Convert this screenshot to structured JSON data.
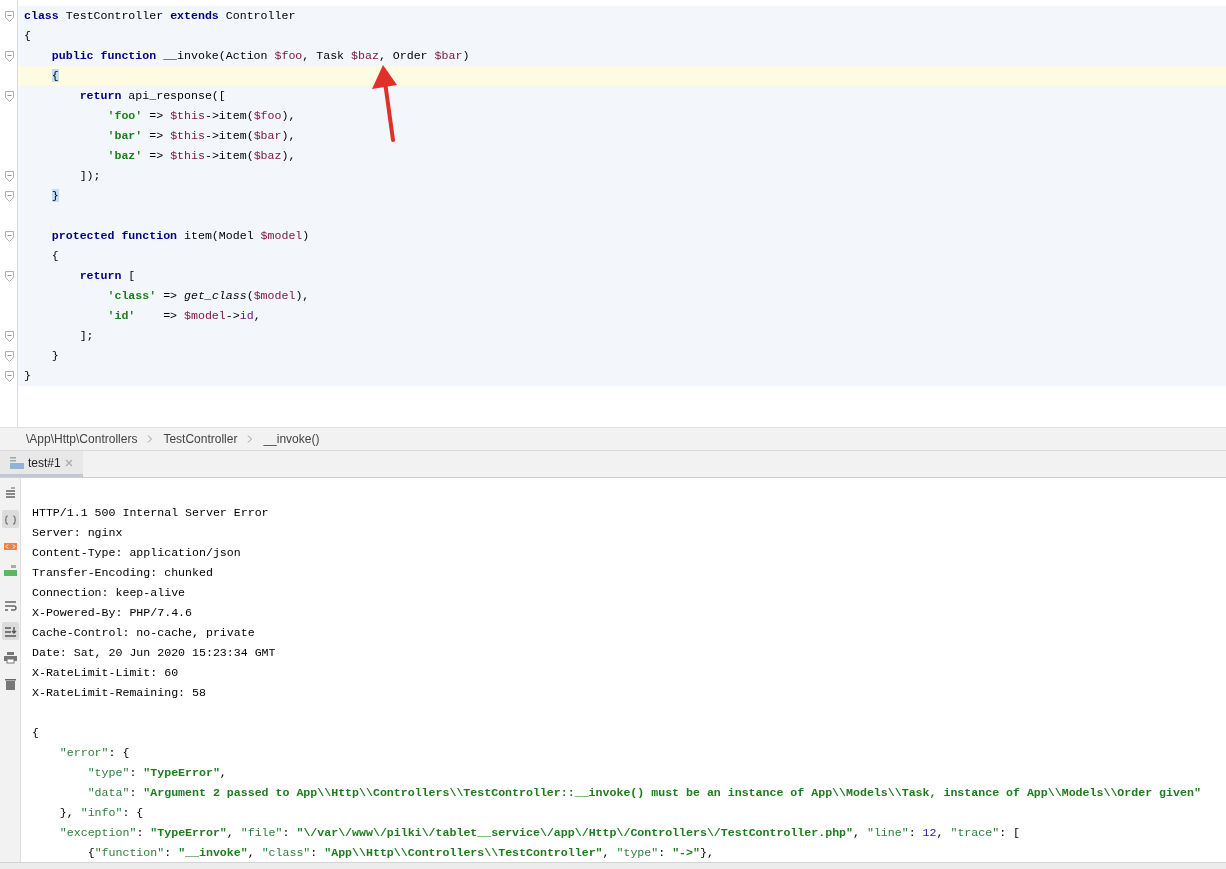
{
  "editor": {
    "lines": [
      {
        "fold": true,
        "current": false,
        "tokens": [
          {
            "kind": "kw",
            "text": "class"
          },
          {
            "kind": "plain",
            "text": " TestController "
          },
          {
            "kind": "kw",
            "text": "extends"
          },
          {
            "kind": "plain",
            "text": " Controller"
          }
        ]
      },
      {
        "fold": false,
        "current": false,
        "tokens": [
          {
            "kind": "plain",
            "text": "{"
          }
        ]
      },
      {
        "fold": true,
        "current": false,
        "tokens": [
          {
            "kind": "kw",
            "text": "    public function"
          },
          {
            "kind": "plain",
            "text": " __invoke(Action "
          },
          {
            "kind": "var",
            "text": "$foo"
          },
          {
            "kind": "plain",
            "text": ", Task "
          },
          {
            "kind": "var",
            "text": "$baz"
          },
          {
            "kind": "plain",
            "text": ", Order "
          },
          {
            "kind": "var",
            "text": "$bar"
          },
          {
            "kind": "plain",
            "text": ")"
          }
        ]
      },
      {
        "fold": false,
        "current": true,
        "brace_match": true,
        "tokens": [
          {
            "kind": "plain",
            "text": "    {"
          }
        ]
      },
      {
        "fold": true,
        "current": false,
        "tokens": [
          {
            "kind": "kw",
            "text": "        return"
          },
          {
            "kind": "plain",
            "text": " api_response(["
          }
        ]
      },
      {
        "fold": false,
        "current": false,
        "tokens": [
          {
            "kind": "str",
            "text": "            'foo'"
          },
          {
            "kind": "plain",
            "text": " => "
          },
          {
            "kind": "var",
            "text": "$this"
          },
          {
            "kind": "plain",
            "text": "->item("
          },
          {
            "kind": "var",
            "text": "$foo"
          },
          {
            "kind": "plain",
            "text": "),"
          }
        ]
      },
      {
        "fold": false,
        "current": false,
        "tokens": [
          {
            "kind": "str",
            "text": "            'bar'"
          },
          {
            "kind": "plain",
            "text": " => "
          },
          {
            "kind": "var",
            "text": "$this"
          },
          {
            "kind": "plain",
            "text": "->item("
          },
          {
            "kind": "var",
            "text": "$bar"
          },
          {
            "kind": "plain",
            "text": "),"
          }
        ]
      },
      {
        "fold": false,
        "current": false,
        "tokens": [
          {
            "kind": "str",
            "text": "            'baz'"
          },
          {
            "kind": "plain",
            "text": " => "
          },
          {
            "kind": "var",
            "text": "$this"
          },
          {
            "kind": "plain",
            "text": "->item("
          },
          {
            "kind": "var",
            "text": "$baz"
          },
          {
            "kind": "plain",
            "text": "),"
          }
        ]
      },
      {
        "fold": true,
        "current": false,
        "tokens": [
          {
            "kind": "plain",
            "text": "        ]);"
          }
        ]
      },
      {
        "fold": true,
        "current": false,
        "brace_match": true,
        "tokens": [
          {
            "kind": "plain",
            "text": "    }"
          }
        ]
      },
      {
        "fold": false,
        "current": false
      },
      {
        "fold": true,
        "current": false,
        "tokens": [
          {
            "kind": "kw",
            "text": "    protected function"
          },
          {
            "kind": "plain",
            "text": " item(Model "
          },
          {
            "kind": "var",
            "text": "$model"
          },
          {
            "kind": "plain",
            "text": ")"
          }
        ]
      },
      {
        "fold": false,
        "current": false,
        "tokens": [
          {
            "kind": "plain",
            "text": "    {"
          }
        ]
      },
      {
        "fold": true,
        "current": false,
        "tokens": [
          {
            "kind": "kw",
            "text": "        return"
          },
          {
            "kind": "plain",
            "text": " ["
          }
        ]
      },
      {
        "fold": false,
        "current": false,
        "tokens": [
          {
            "kind": "str",
            "text": "            'class'"
          },
          {
            "kind": "plain",
            "text": " => "
          },
          {
            "kind": "italic",
            "text": "get_class"
          },
          {
            "kind": "plain",
            "text": "("
          },
          {
            "kind": "var",
            "text": "$model"
          },
          {
            "kind": "plain",
            "text": "),"
          }
        ]
      },
      {
        "fold": false,
        "current": false,
        "tokens": [
          {
            "kind": "str",
            "text": "            'id'"
          },
          {
            "kind": "plain",
            "text": "    => "
          },
          {
            "kind": "var",
            "text": "$model"
          },
          {
            "kind": "plain",
            "text": "->"
          },
          {
            "kind": "field",
            "text": "id"
          },
          {
            "kind": "plain",
            "text": ","
          }
        ]
      },
      {
        "fold": true,
        "current": false,
        "tokens": [
          {
            "kind": "plain",
            "text": "        ];"
          }
        ]
      },
      {
        "fold": true,
        "current": false,
        "tokens": [
          {
            "kind": "plain",
            "text": "    }"
          }
        ]
      },
      {
        "fold": true,
        "current": false,
        "tokens": [
          {
            "kind": "plain",
            "text": "}"
          }
        ]
      }
    ]
  },
  "breadcrumbs": [
    "\\App\\Http\\Controllers",
    "TestController",
    "__invoke()"
  ],
  "tool_tab": {
    "label": "test#1",
    "selected": true
  },
  "toolbar": [
    {
      "kind": "text",
      "selected": false
    },
    {
      "kind": "json",
      "selected": true
    },
    {
      "kind": "xml",
      "selected": false
    },
    {
      "kind": "html",
      "selected": false
    },
    {
      "kind": "wrap",
      "selected": false
    },
    {
      "kind": "scroll",
      "selected": true
    },
    {
      "kind": "print",
      "selected": false
    },
    {
      "kind": "delete",
      "selected": false
    }
  ],
  "output": {
    "headers": [
      "HTTP/1.1 500 Internal Server Error",
      "Server: nginx",
      "Content-Type: application/json",
      "Transfer-Encoding: chunked",
      "Connection: keep-alive",
      "X-Powered-By: PHP/7.4.6",
      "Cache-Control: no-cache, private",
      "Date: Sat, 20 Jun 2020 15:23:34 GMT",
      "X-RateLimit-Limit: 60",
      "X-RateLimit-Remaining: 58"
    ],
    "body": [
      {
        "tokens": [
          {
            "kind": "plain",
            "text": "{"
          }
        ]
      },
      {
        "tokens": [
          {
            "kind": "key",
            "text": "    \"error\""
          },
          {
            "kind": "plain",
            "text": ": {"
          }
        ]
      },
      {
        "tokens": [
          {
            "kind": "key",
            "text": "        \"type\""
          },
          {
            "kind": "plain",
            "text": ": "
          },
          {
            "kind": "str",
            "text": "\"TypeError\""
          },
          {
            "kind": "plain",
            "text": ","
          }
        ]
      },
      {
        "tokens": [
          {
            "kind": "key",
            "text": "        \"data\""
          },
          {
            "kind": "plain",
            "text": ": "
          },
          {
            "kind": "str",
            "text": "\"Argument 2 passed to App\\\\Http\\\\Controllers\\\\TestController::__invoke() must be an instance of App\\\\Models\\\\Task, instance of App\\\\Models\\\\Order given\""
          }
        ]
      },
      {
        "tokens": [
          {
            "kind": "plain",
            "text": "    }, "
          },
          {
            "kind": "key",
            "text": "\"info\""
          },
          {
            "kind": "plain",
            "text": ": {"
          }
        ]
      },
      {
        "tokens": [
          {
            "kind": "key",
            "text": "    \"exception\""
          },
          {
            "kind": "plain",
            "text": ": "
          },
          {
            "kind": "str",
            "text": "\"TypeError\""
          },
          {
            "kind": "plain",
            "text": ", "
          },
          {
            "kind": "key",
            "text": "\"file\""
          },
          {
            "kind": "plain",
            "text": ": "
          },
          {
            "kind": "str",
            "text": "\"\\/var\\/www\\/pilki\\/tablet__service\\/app\\/Http\\/Controllers\\/TestController.php\""
          },
          {
            "kind": "plain",
            "text": ", "
          },
          {
            "kind": "key",
            "text": "\"line\""
          },
          {
            "kind": "plain",
            "text": ": "
          },
          {
            "kind": "num",
            "text": "12"
          },
          {
            "kind": "plain",
            "text": ", "
          },
          {
            "kind": "key",
            "text": "\"trace\""
          },
          {
            "kind": "plain",
            "text": ": ["
          }
        ]
      },
      {
        "tokens": [
          {
            "kind": "plain",
            "text": "        {"
          },
          {
            "kind": "key",
            "text": "\"function\""
          },
          {
            "kind": "plain",
            "text": ": "
          },
          {
            "kind": "str",
            "text": "\"__invoke\""
          },
          {
            "kind": "plain",
            "text": ", "
          },
          {
            "kind": "key",
            "text": "\"class\""
          },
          {
            "kind": "plain",
            "text": ": "
          },
          {
            "kind": "str",
            "text": "\"App\\\\Http\\\\Controllers\\\\TestController\""
          },
          {
            "kind": "plain",
            "text": ", "
          },
          {
            "kind": "key",
            "text": "\"type\""
          },
          {
            "kind": "plain",
            "text": ": "
          },
          {
            "kind": "str",
            "text": "\"->\""
          },
          {
            "kind": "plain",
            "text": "},"
          }
        ]
      }
    ]
  }
}
